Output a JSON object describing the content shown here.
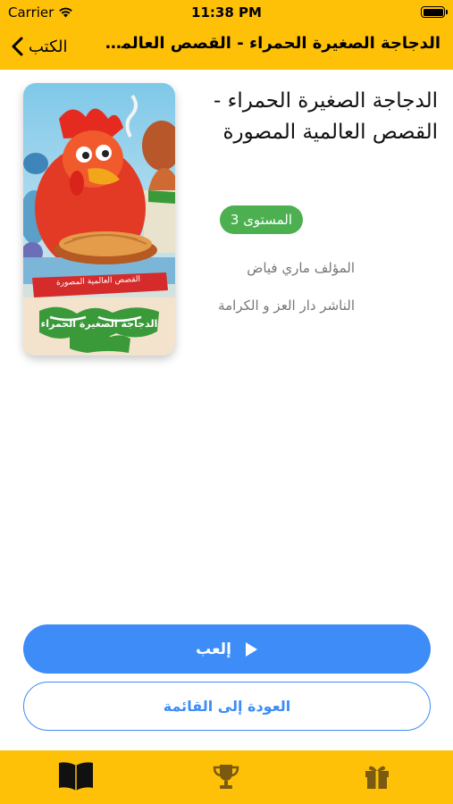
{
  "status_bar": {
    "carrier": "Carrier",
    "time": "11:38 PM"
  },
  "nav": {
    "back_label": "الكتب",
    "title": "الدجاجة الصغيرة الحمراء - القصص العالمية المصورة"
  },
  "book": {
    "title": "الدجاجة الصغيرة الحمراء - القصص العالمية المصورة",
    "level": "المستوى 3",
    "author": "المؤلف ماري فياض",
    "publisher": "الناشر دار العز و الكرامة",
    "cover": {
      "banner_text": "القصص العالمية المصورة",
      "title_text": "الدجاجة الصغيرة الحمراء"
    }
  },
  "actions": {
    "play_label": "إلعب",
    "back_to_list_label": "العودة إلى القائمة"
  },
  "tabs": [
    {
      "icon": "book-icon",
      "active": true
    },
    {
      "icon": "trophy-icon",
      "active": false
    },
    {
      "icon": "gift-icon",
      "active": false
    }
  ],
  "colors": {
    "accent_yellow": "#FFC107",
    "primary_blue": "#3D8CF7",
    "badge_green": "#4CAF50"
  }
}
